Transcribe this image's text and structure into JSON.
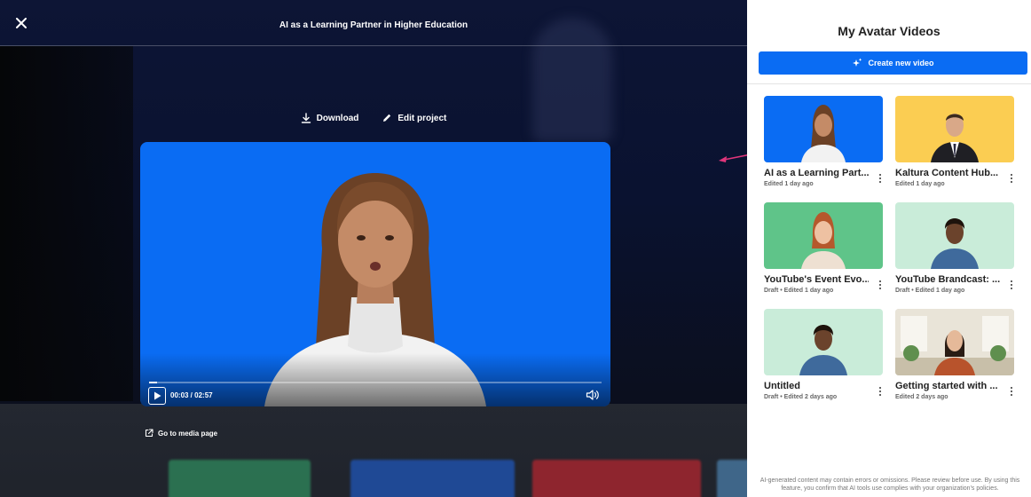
{
  "viewer": {
    "title": "AI as a Learning Partner in Higher Education",
    "download_label": "Download",
    "edit_label": "Edit project",
    "timecode": "00:03 / 02:57",
    "progress_fraction": 0.017,
    "media_link_label": "Go to media page"
  },
  "panel": {
    "title": "My Avatar Videos",
    "create_label": "Create new video",
    "disclaimer": "AI-generated content may contain errors or omissions. Please review before use. By using this feature, you confirm that AI tools use complies with your organization's policies."
  },
  "videos": [
    {
      "title": "AI as a Learning Part...",
      "meta": "Edited 1 day ago",
      "bg": "#0a6cf3"
    },
    {
      "title": "Kaltura Content Hub...",
      "meta": "Edited 1 day ago",
      "bg": "#fbcd52"
    },
    {
      "title": "YouTube's Event Evo...",
      "meta": "Draft  •  Edited 1 day ago",
      "bg": "#5fc489"
    },
    {
      "title": "YouTube Brandcast: ...",
      "meta": "Draft  •  Edited 1 day ago",
      "bg": "#c9ecd9"
    },
    {
      "title": "Untitled",
      "meta": "Draft  •  Edited 2 days ago",
      "bg": "#c9ecd9"
    },
    {
      "title": "Getting started with ...",
      "meta": "Edited 2 days ago",
      "bg": "#d9d4c7"
    }
  ],
  "colors": {
    "accent": "#0a6cf3",
    "arrow": "#e0357a"
  }
}
